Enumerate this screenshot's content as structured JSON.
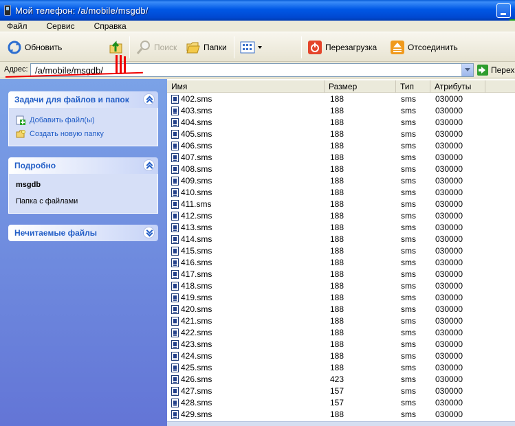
{
  "window": {
    "title": "Мой телефон: /a/mobile/msgdb/"
  },
  "menu": [
    "Файл",
    "Сервис",
    "Справка"
  ],
  "toolbar": {
    "refresh": "Обновить",
    "search": "Поиск",
    "folders": "Папки",
    "restart": "Перезагрузка",
    "disconnect": "Отсоединить"
  },
  "address": {
    "label": "Адрес:",
    "value": "/a/mobile/msgdb/",
    "go": "Перех"
  },
  "sidebar": {
    "tasks": {
      "title": "Задачи для файлов и папок",
      "items": [
        "Добавить файл(ы)",
        "Создать новую папку"
      ]
    },
    "details": {
      "title": "Подробно",
      "name": "msgdb",
      "type": "Папка с файлами"
    },
    "unreadable": {
      "title": "Нечитаемые файлы"
    }
  },
  "columns": {
    "name": "Имя",
    "size": "Размер",
    "type": "Тип",
    "attrs": "Атрибуты"
  },
  "files": [
    {
      "name": "402.sms",
      "size": "188",
      "type": "sms",
      "attrs": "030000"
    },
    {
      "name": "403.sms",
      "size": "188",
      "type": "sms",
      "attrs": "030000"
    },
    {
      "name": "404.sms",
      "size": "188",
      "type": "sms",
      "attrs": "030000"
    },
    {
      "name": "405.sms",
      "size": "188",
      "type": "sms",
      "attrs": "030000"
    },
    {
      "name": "406.sms",
      "size": "188",
      "type": "sms",
      "attrs": "030000"
    },
    {
      "name": "407.sms",
      "size": "188",
      "type": "sms",
      "attrs": "030000"
    },
    {
      "name": "408.sms",
      "size": "188",
      "type": "sms",
      "attrs": "030000"
    },
    {
      "name": "409.sms",
      "size": "188",
      "type": "sms",
      "attrs": "030000"
    },
    {
      "name": "410.sms",
      "size": "188",
      "type": "sms",
      "attrs": "030000"
    },
    {
      "name": "411.sms",
      "size": "188",
      "type": "sms",
      "attrs": "030000"
    },
    {
      "name": "412.sms",
      "size": "188",
      "type": "sms",
      "attrs": "030000"
    },
    {
      "name": "413.sms",
      "size": "188",
      "type": "sms",
      "attrs": "030000"
    },
    {
      "name": "414.sms",
      "size": "188",
      "type": "sms",
      "attrs": "030000"
    },
    {
      "name": "415.sms",
      "size": "188",
      "type": "sms",
      "attrs": "030000"
    },
    {
      "name": "416.sms",
      "size": "188",
      "type": "sms",
      "attrs": "030000"
    },
    {
      "name": "417.sms",
      "size": "188",
      "type": "sms",
      "attrs": "030000"
    },
    {
      "name": "418.sms",
      "size": "188",
      "type": "sms",
      "attrs": "030000"
    },
    {
      "name": "419.sms",
      "size": "188",
      "type": "sms",
      "attrs": "030000"
    },
    {
      "name": "420.sms",
      "size": "188",
      "type": "sms",
      "attrs": "030000"
    },
    {
      "name": "421.sms",
      "size": "188",
      "type": "sms",
      "attrs": "030000"
    },
    {
      "name": "422.sms",
      "size": "188",
      "type": "sms",
      "attrs": "030000"
    },
    {
      "name": "423.sms",
      "size": "188",
      "type": "sms",
      "attrs": "030000"
    },
    {
      "name": "424.sms",
      "size": "188",
      "type": "sms",
      "attrs": "030000"
    },
    {
      "name": "425.sms",
      "size": "188",
      "type": "sms",
      "attrs": "030000"
    },
    {
      "name": "426.sms",
      "size": "423",
      "type": "sms",
      "attrs": "030000"
    },
    {
      "name": "427.sms",
      "size": "157",
      "type": "sms",
      "attrs": "030000"
    },
    {
      "name": "428.sms",
      "size": "157",
      "type": "sms",
      "attrs": "030000"
    },
    {
      "name": "429.sms",
      "size": "188",
      "type": "sms",
      "attrs": "030000"
    }
  ],
  "colors": {
    "titlebar": "#0058E6",
    "sidebar": "#7BA2E7",
    "link": "#215DC6",
    "annotation": "#E00000"
  }
}
